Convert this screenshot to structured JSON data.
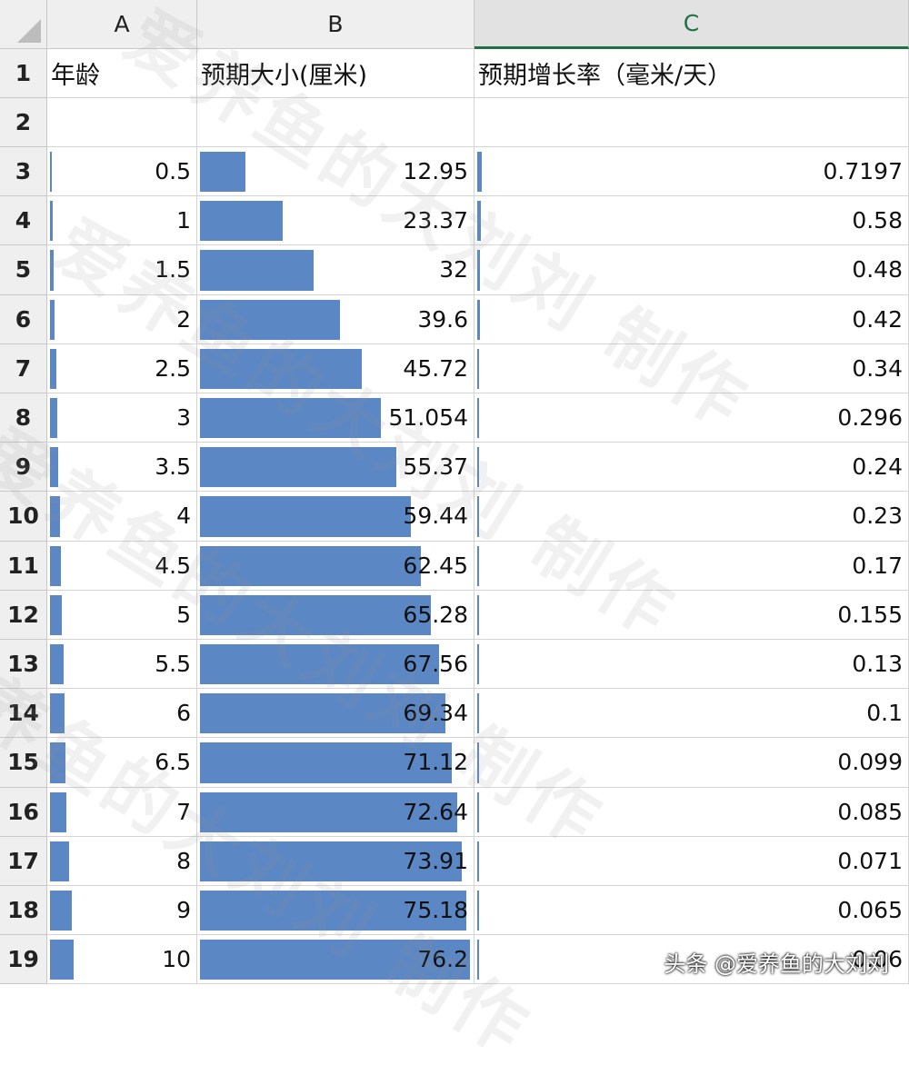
{
  "columns": [
    "A",
    "B",
    "C"
  ],
  "selected_column": "C",
  "header_row": {
    "row_num": "1",
    "a": "年龄",
    "b": "预期大小(厘米)",
    "c": "预期增长率（毫米/天）"
  },
  "empty_row_num": "2",
  "rows": [
    {
      "row": "3",
      "age": "0.5",
      "size": "12.95",
      "rate": "0.7197"
    },
    {
      "row": "4",
      "age": "1",
      "size": "23.37",
      "rate": "0.58"
    },
    {
      "row": "5",
      "age": "1.5",
      "size": "32",
      "rate": "0.48"
    },
    {
      "row": "6",
      "age": "2",
      "size": "39.6",
      "rate": "0.42"
    },
    {
      "row": "7",
      "age": "2.5",
      "size": "45.72",
      "rate": "0.34"
    },
    {
      "row": "8",
      "age": "3",
      "size": "51.054",
      "rate": "0.296"
    },
    {
      "row": "9",
      "age": "3.5",
      "size": "55.37",
      "rate": "0.24"
    },
    {
      "row": "10",
      "age": "4",
      "size": "59.44",
      "rate": "0.23"
    },
    {
      "row": "11",
      "age": "4.5",
      "size": "62.45",
      "rate": "0.17"
    },
    {
      "row": "12",
      "age": "5",
      "size": "65.28",
      "rate": "0.155"
    },
    {
      "row": "13",
      "age": "5.5",
      "size": "67.56",
      "rate": "0.13"
    },
    {
      "row": "14",
      "age": "6",
      "size": "69.34",
      "rate": "0.1"
    },
    {
      "row": "15",
      "age": "6.5",
      "size": "71.12",
      "rate": "0.099"
    },
    {
      "row": "16",
      "age": "7",
      "size": "72.64",
      "rate": "0.085"
    },
    {
      "row": "17",
      "age": "8",
      "size": "73.91",
      "rate": "0.071"
    },
    {
      "row": "18",
      "age": "9",
      "size": "75.18",
      "rate": "0.065"
    },
    {
      "row": "19",
      "age": "10",
      "size": "76.2",
      "rate": "0.06"
    }
  ],
  "data_bar_color": "#5b87c5",
  "data_bar_max": {
    "age": 10,
    "size": 76.2,
    "rate": 0.7197
  },
  "watermark_text": "爱养鱼的大刘刘 制作",
  "credit_text": "头条 @爱养鱼的大刘刘"
}
